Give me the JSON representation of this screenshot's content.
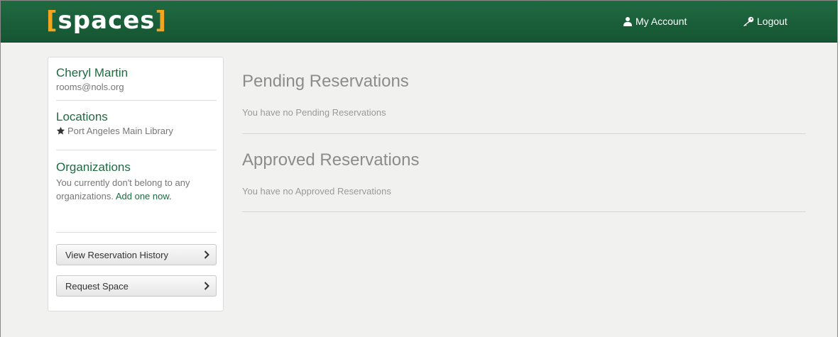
{
  "navbar": {
    "logo_open": "[",
    "logo_word": "spaces",
    "logo_close": "]",
    "my_account_label": "My Account",
    "my_account_icon": "user-icon",
    "logout_label": "Logout",
    "logout_icon": "key-icon",
    "bg_color": "#1f6a41",
    "logo_accent": "#f2a51f"
  },
  "sidebar": {
    "user_name": "Cheryl Martin",
    "user_email": "rooms@nols.org",
    "locations_heading": "Locations",
    "location_name": "Port Angeles Main Library",
    "location_icon": "star-icon",
    "organizations_heading": "Organizations",
    "organizations_text": "You currently don't belong to any organizations.",
    "organizations_link": "Add one now.",
    "buttons": {
      "history": "View Reservation History",
      "request": "Request Space"
    }
  },
  "main": {
    "pending_title": "Pending Reservations",
    "pending_empty": "You have no Pending Reservations",
    "approved_title": "Approved Reservations",
    "approved_empty": "You have no Approved Reservations"
  }
}
